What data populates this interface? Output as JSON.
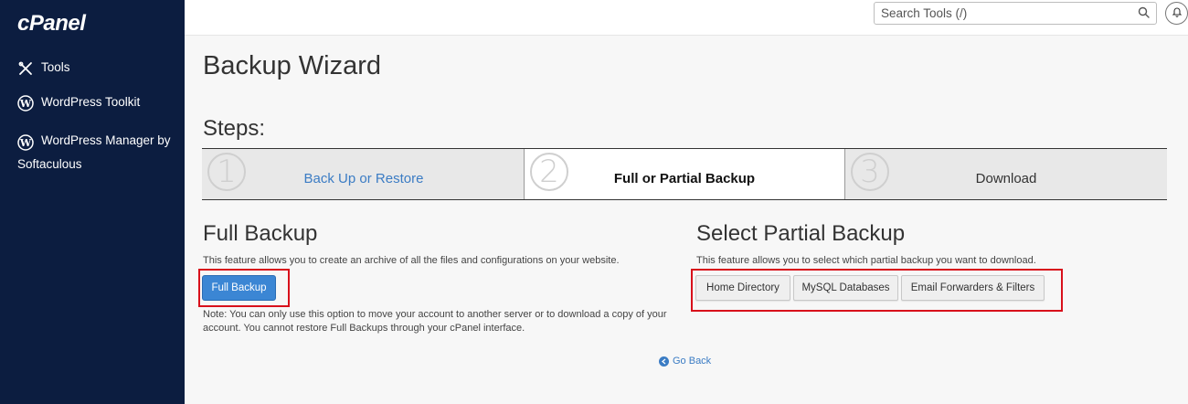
{
  "app": {
    "logo": "cPanel"
  },
  "sidebar": {
    "items": [
      {
        "label": "Tools",
        "icon": "tools-icon"
      },
      {
        "label": "WordPress Toolkit",
        "icon": "wordpress-icon"
      },
      {
        "label": "WordPress Manager by Softaculous",
        "icon": "wordpress-icon"
      }
    ]
  },
  "header": {
    "search_placeholder": "Search Tools (/)",
    "search_icon": "search-icon",
    "notification_icon": "bell-icon"
  },
  "main": {
    "title": "Backup Wizard",
    "steps_title": "Steps:",
    "steps": [
      {
        "number": "1",
        "label": "Back Up or Restore",
        "state": "link"
      },
      {
        "number": "2",
        "label": "Full or Partial Backup",
        "state": "active"
      },
      {
        "number": "3",
        "label": "Download",
        "state": "inactive"
      }
    ],
    "full_backup": {
      "title": "Full Backup",
      "description": "This feature allows you to create an archive of all the files and configurations on your website.",
      "button": "Full Backup",
      "note": "Note: You can only use this option to move your account to another server or to download a copy of your account. You cannot restore Full Backups through your cPanel interface."
    },
    "partial_backup": {
      "title": "Select Partial Backup",
      "description": "This feature allows you to select which partial backup you want to download.",
      "buttons": [
        "Home Directory",
        "MySQL Databases",
        "Email Forwarders & Filters"
      ]
    },
    "go_back": "Go Back"
  },
  "colors": {
    "sidebar_bg": "#0c1d40",
    "primary_button": "#3b86d4",
    "link": "#3b7cc4",
    "highlight": "#d8101b"
  }
}
